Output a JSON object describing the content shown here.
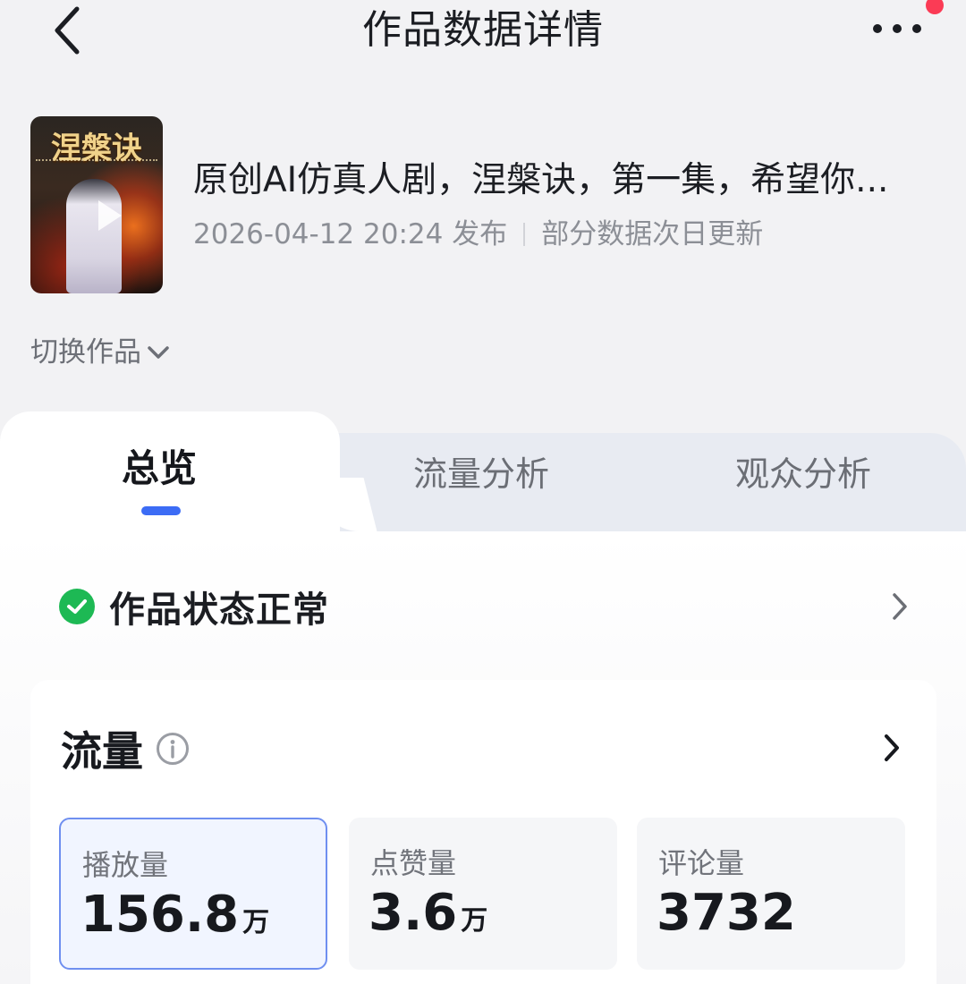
{
  "header": {
    "title": "作品数据详情",
    "back_icon": "chevron-left-icon",
    "more_icon": "more-dots-icon",
    "notification_dot_color": "#fb3b55"
  },
  "video": {
    "cover_text": "涅槃诀",
    "title": "原创AI仿真人剧，涅槃诀，第一集，希望你...",
    "publish_time": "2026-04-12 20:24 发布",
    "update_note": "部分数据次日更新"
  },
  "switch_work": {
    "label": "切换作品",
    "icon": "chevron-down-icon"
  },
  "tabs": [
    {
      "label": "总览",
      "active": true
    },
    {
      "label": "流量分析",
      "active": false
    },
    {
      "label": "观众分析",
      "active": false
    }
  ],
  "accent_color": "#3c6cf5",
  "status": {
    "text": "作品状态正常",
    "icon": "check-circle-icon",
    "color": "#1db954"
  },
  "traffic": {
    "title": "流量",
    "info_icon": "info-icon",
    "metrics": [
      {
        "label": "播放量",
        "value": "156.8",
        "unit": "万",
        "selected": true
      },
      {
        "label": "点赞量",
        "value": "3.6",
        "unit": "万",
        "selected": false
      },
      {
        "label": "评论量",
        "value": "3732",
        "unit": "",
        "selected": false
      }
    ]
  }
}
